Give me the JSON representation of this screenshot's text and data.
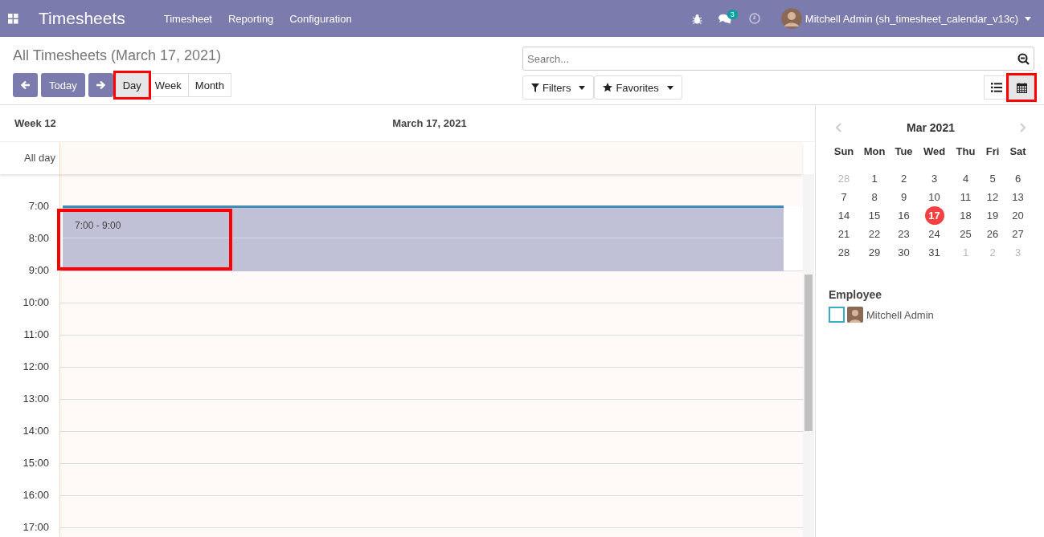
{
  "navbar": {
    "app_title": "Timesheets",
    "menu": [
      "Timesheet",
      "Reporting",
      "Configuration"
    ],
    "chat_count": "3",
    "user": "Mitchell Admin (sh_timesheet_calendar_v13c)"
  },
  "control_panel": {
    "title": "All Timesheets (March 17, 2021)",
    "today": "Today",
    "scales": [
      {
        "label": "Day",
        "selected": true,
        "highlighted": true
      },
      {
        "label": "Week",
        "selected": false,
        "highlighted": false
      },
      {
        "label": "Month",
        "selected": false,
        "highlighted": false
      }
    ],
    "search": {
      "placeholder": "Search..."
    },
    "filters": "Filters",
    "favorites": "Favorites",
    "views": [
      {
        "kind": "list",
        "selected": false,
        "highlighted": false
      },
      {
        "kind": "calendar",
        "selected": true,
        "highlighted": true
      }
    ]
  },
  "calendar": {
    "week": "Week 12",
    "day": "March 17, 2021",
    "all_day": "All day",
    "hours": [
      {
        "label": "7:00",
        "booked": true,
        "event": {
          "time": "7:00 - 9:00",
          "highlighted": true
        }
      },
      {
        "label": "8:00",
        "booked": true
      },
      {
        "label": "9:00",
        "booked": false
      },
      {
        "label": "10:00",
        "booked": false
      },
      {
        "label": "11:00",
        "booked": false
      },
      {
        "label": "12:00",
        "booked": false
      },
      {
        "label": "13:00",
        "booked": false
      },
      {
        "label": "14:00",
        "booked": false
      },
      {
        "label": "15:00",
        "booked": false
      },
      {
        "label": "16:00",
        "booked": false
      },
      {
        "label": "17:00",
        "booked": false
      }
    ]
  },
  "sidebar": {
    "month": "Mar 2021",
    "weekdays": [
      "Sun",
      "Mon",
      "Tue",
      "Wed",
      "Thu",
      "Fri",
      "Sat"
    ],
    "days": [
      {
        "label": "28",
        "other_month": true,
        "selected": false
      },
      {
        "label": "1",
        "other_month": false,
        "selected": false
      },
      {
        "label": "2",
        "other_month": false,
        "selected": false
      },
      {
        "label": "3",
        "other_month": false,
        "selected": false
      },
      {
        "label": "4",
        "other_month": false,
        "selected": false
      },
      {
        "label": "5",
        "other_month": false,
        "selected": false
      },
      {
        "label": "6",
        "other_month": false,
        "selected": false
      },
      {
        "label": "7",
        "other_month": false,
        "selected": false
      },
      {
        "label": "8",
        "other_month": false,
        "selected": false
      },
      {
        "label": "9",
        "other_month": false,
        "selected": false
      },
      {
        "label": "10",
        "other_month": false,
        "selected": false
      },
      {
        "label": "11",
        "other_month": false,
        "selected": false
      },
      {
        "label": "12",
        "other_month": false,
        "selected": false
      },
      {
        "label": "13",
        "other_month": false,
        "selected": false
      },
      {
        "label": "14",
        "other_month": false,
        "selected": false
      },
      {
        "label": "15",
        "other_month": false,
        "selected": false
      },
      {
        "label": "16",
        "other_month": false,
        "selected": false
      },
      {
        "label": "17",
        "other_month": false,
        "selected": true
      },
      {
        "label": "18",
        "other_month": false,
        "selected": false
      },
      {
        "label": "19",
        "other_month": false,
        "selected": false
      },
      {
        "label": "20",
        "other_month": false,
        "selected": false
      },
      {
        "label": "21",
        "other_month": false,
        "selected": false
      },
      {
        "label": "22",
        "other_month": false,
        "selected": false
      },
      {
        "label": "23",
        "other_month": false,
        "selected": false
      },
      {
        "label": "24",
        "other_month": false,
        "selected": false
      },
      {
        "label": "25",
        "other_month": false,
        "selected": false
      },
      {
        "label": "26",
        "other_month": false,
        "selected": false
      },
      {
        "label": "27",
        "other_month": false,
        "selected": false
      },
      {
        "label": "28",
        "other_month": false,
        "selected": false
      },
      {
        "label": "29",
        "other_month": false,
        "selected": false
      },
      {
        "label": "30",
        "other_month": false,
        "selected": false
      },
      {
        "label": "31",
        "other_month": false,
        "selected": false
      },
      {
        "label": "1",
        "other_month": true,
        "selected": false
      },
      {
        "label": "2",
        "other_month": true,
        "selected": false
      },
      {
        "label": "3",
        "other_month": true,
        "selected": false
      }
    ],
    "filter_title": "Employee",
    "employees": [
      {
        "name": "Mitchell Admin",
        "checked": false
      }
    ]
  }
}
